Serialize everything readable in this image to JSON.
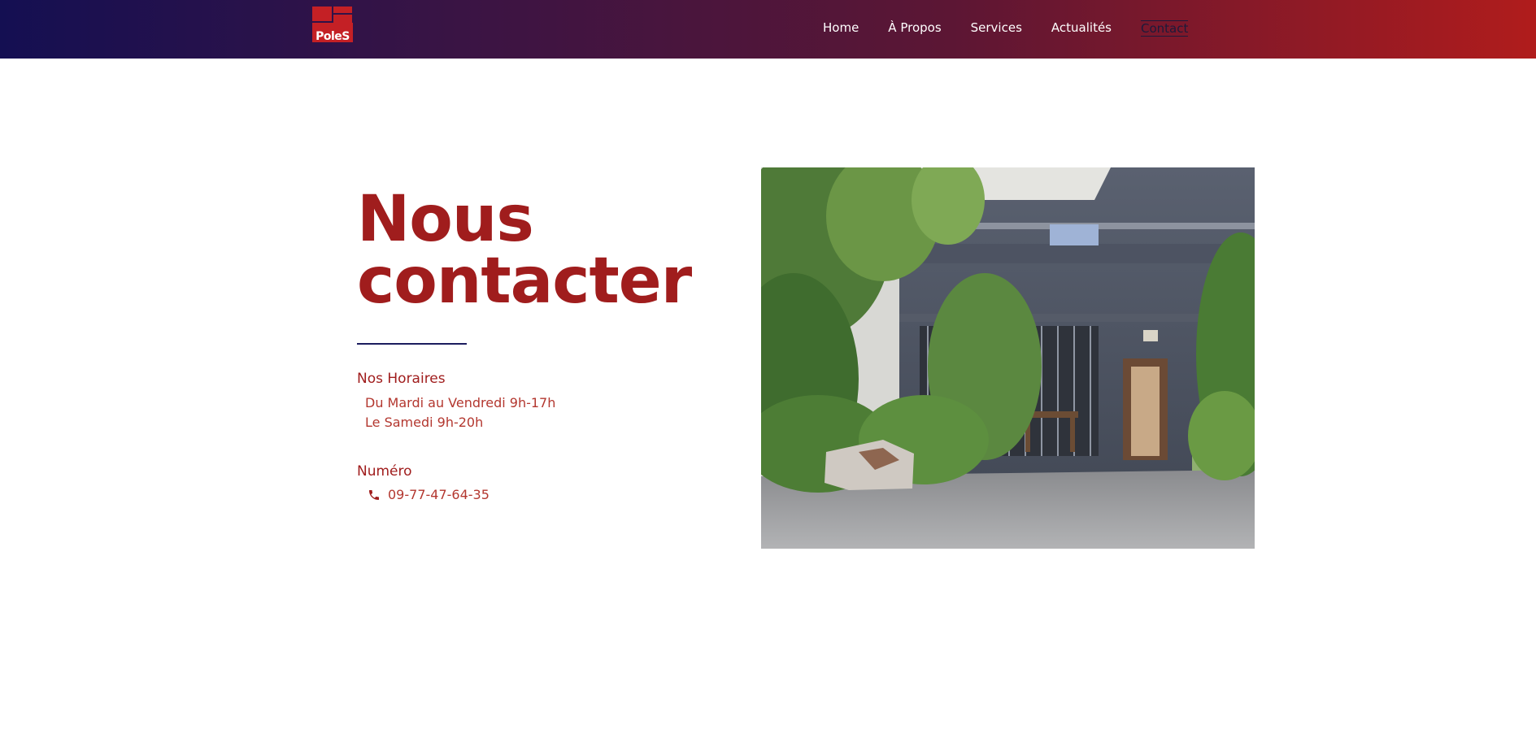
{
  "brand": {
    "logo_text": "PoleS",
    "colors": {
      "navy": "#140f52",
      "red": "#a01d1d",
      "accent_red": "#b01c1c"
    }
  },
  "nav": {
    "items": [
      "Home",
      "À Propos",
      "Services",
      "Actualités",
      "Contact"
    ],
    "active": "Contact"
  },
  "page": {
    "heading_line1": "Nous",
    "heading_line2": "contacter"
  },
  "hours": {
    "label": "Nos Horaires",
    "lines": [
      "Du Mardi au Vendredi 9h-17h",
      "Le Samedi 9h-20h"
    ]
  },
  "phone": {
    "label": "Numéro",
    "number": "09-77-47-64-35",
    "icon": "phone-icon"
  },
  "photo": {
    "icon": "building-entrance-photo"
  }
}
